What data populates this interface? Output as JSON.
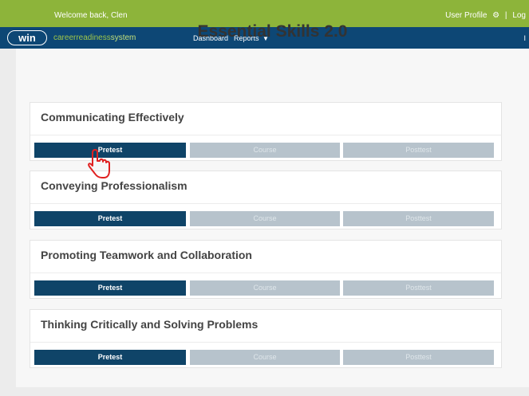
{
  "topbar": {
    "welcome": "Welcome back, Clen",
    "user_profile": "User Profile",
    "gear_icon": "gear-icon",
    "logout": "Log"
  },
  "navbar": {
    "logo": "win",
    "brand_prefix": "careerreadiness",
    "brand_suffix": "system",
    "dashboard": "Dashboard",
    "reports": "Reports",
    "right_char": "I"
  },
  "page": {
    "title": "Essential Skills 2.0"
  },
  "modules": [
    {
      "title": "Communicating Effectively",
      "pretest": "Pretest",
      "course": "Course",
      "posttest": "Posttest"
    },
    {
      "title": "Conveying Professionalism",
      "pretest": "Pretest",
      "course": "Course",
      "posttest": "Posttest"
    },
    {
      "title": "Promoting Teamwork and Collaboration",
      "pretest": "Pretest",
      "course": "Course",
      "posttest": "Posttest"
    },
    {
      "title": "Thinking Critically and Solving Problems",
      "pretest": "Pretest",
      "course": "Course",
      "posttest": "Posttest"
    }
  ],
  "colors": {
    "topbar": "#8db43a",
    "navbar": "#0d4775",
    "pretest": "#0f4468",
    "inactive": "#b7c3cc",
    "cursor": "#e02020"
  }
}
